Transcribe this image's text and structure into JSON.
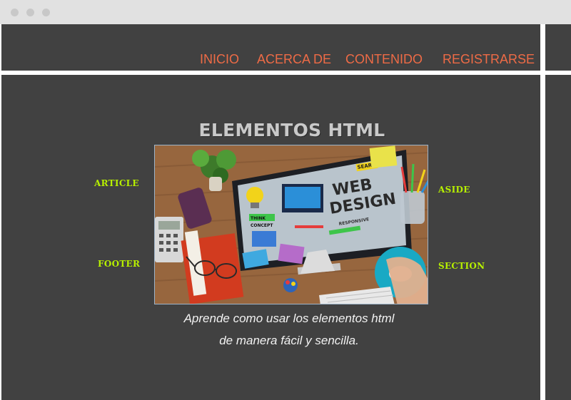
{
  "nav": {
    "items": [
      "INICIO",
      "ACERCA DE",
      "CONTENIDO",
      "REGISTRARSE"
    ]
  },
  "hero": {
    "title": "ELEMENTOS HTML",
    "image_text": [
      "WEB",
      "DESIGN",
      "SEARCH",
      "THINK",
      "CONCEPT",
      "RESPONSIVE"
    ],
    "caption_line1": "Aprende como usar los elementos html",
    "caption_line2": "de manera fácil y sencilla."
  },
  "tags": {
    "article": "ARTICLE",
    "aside": "ASIDE",
    "footer": "FOOTER",
    "section": "SECTION"
  },
  "colors": {
    "nav_link": "#ee6b46",
    "tag": "#b7f000",
    "background": "#414141"
  }
}
